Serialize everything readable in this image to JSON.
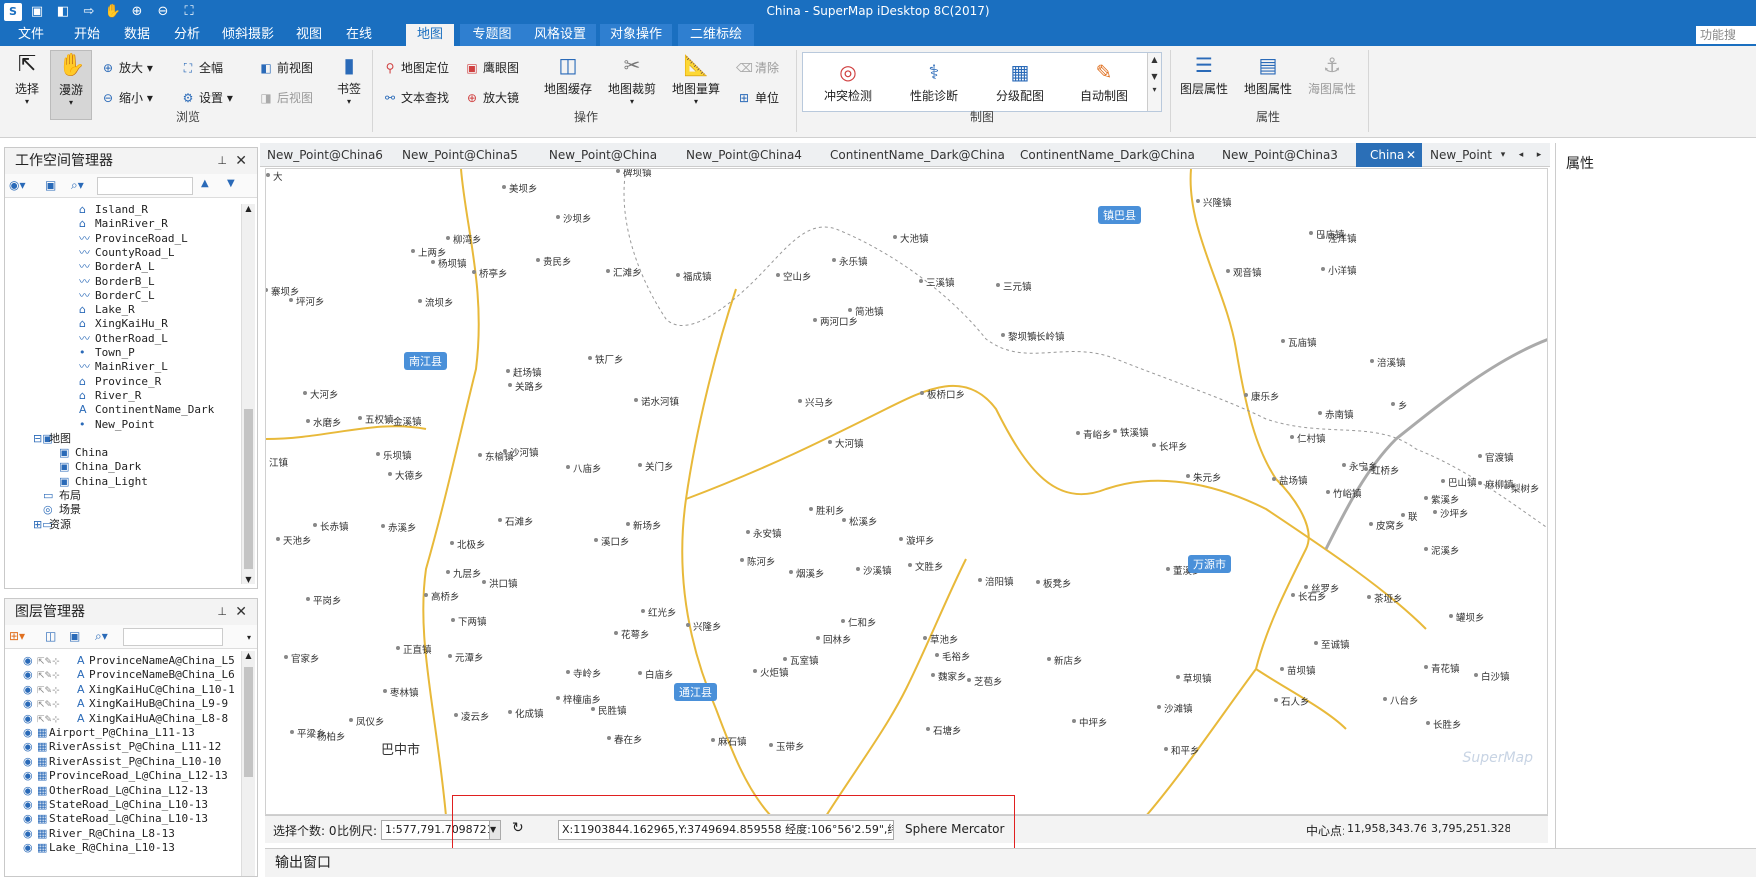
{
  "window": {
    "title": "China - SuperMap iDesktop 8C(2017)"
  },
  "quick_access": [
    "app-logo-icon",
    "save-icon",
    "open-icon",
    "forward-icon",
    "pan-icon",
    "zoom-in-icon",
    "zoom-out-icon",
    "fit-icon"
  ],
  "menus": [
    {
      "label": "文件"
    },
    {
      "label": "开始"
    },
    {
      "label": "数据"
    },
    {
      "label": "分析"
    },
    {
      "label": "倾斜摄影"
    },
    {
      "label": "视图"
    },
    {
      "label": "在线"
    },
    {
      "label": "地图"
    },
    {
      "label": "专题图"
    },
    {
      "label": "风格设置"
    },
    {
      "label": "对象操作"
    },
    {
      "label": "二维标绘"
    }
  ],
  "search": {
    "placeholder": "功能搜"
  },
  "ribbon": {
    "browse": {
      "label": "浏览",
      "select": "选择",
      "pan": "漫游",
      "zoom_in": "放大",
      "zoom_out": "缩小",
      "full_extent": "全幅",
      "settings": "设置",
      "prev_view": "前视图",
      "next_view": "后视图",
      "bookmark": "书签"
    },
    "ops": {
      "label": "操作",
      "map_locate": "地图定位",
      "eagle_eye": "鹰眼图",
      "text_search": "文本查找",
      "magnifier": "放大镜",
      "map_cache": "地图缓存",
      "map_clip": "地图裁剪",
      "map_measure": "地图量算",
      "clear": "清除",
      "unit": "单位"
    },
    "mapping": {
      "label": "制图",
      "conflict": "冲突检测",
      "perf": "性能诊断",
      "graded": "分级配图",
      "auto": "自动制图"
    },
    "props": {
      "label": "属性",
      "layer_props": "图层属性",
      "map_props": "地图属性",
      "chart_props": "海图属性"
    }
  },
  "workspace": {
    "title": "工作空间管理器",
    "items": [
      {
        "label": "Island_R",
        "icon": "region"
      },
      {
        "label": "MainRiver_R",
        "icon": "region"
      },
      {
        "label": "ProvinceRoad_L",
        "icon": "line"
      },
      {
        "label": "CountyRoad_L",
        "icon": "line"
      },
      {
        "label": "BorderA_L",
        "icon": "line"
      },
      {
        "label": "BorderB_L",
        "icon": "line"
      },
      {
        "label": "BorderC_L",
        "icon": "line"
      },
      {
        "label": "Lake_R",
        "icon": "region"
      },
      {
        "label": "XingKaiHu_R",
        "icon": "region"
      },
      {
        "label": "OtherRoad_L",
        "icon": "line"
      },
      {
        "label": "Town_P",
        "icon": "point"
      },
      {
        "label": "MainRiver_L",
        "icon": "line"
      },
      {
        "label": "Province_R",
        "icon": "region"
      },
      {
        "label": "River_R",
        "icon": "region"
      },
      {
        "label": "ContinentName_Dark",
        "icon": "text"
      },
      {
        "label": "New_Point",
        "icon": "point"
      }
    ],
    "maps_label": "地图",
    "maps": [
      "China",
      "China_Dark",
      "China_Light"
    ],
    "layout": "布局",
    "scene": "场景",
    "resources": "资源"
  },
  "layers": {
    "title": "图层管理器",
    "items": [
      {
        "label": "ProvinceNameA@China_L5",
        "icon": "A"
      },
      {
        "label": "ProvinceNameB@China_L6",
        "icon": "A"
      },
      {
        "label": "XingKaiHuC@China_L10-1",
        "icon": "A"
      },
      {
        "label": "XingKaiHuB@China_L9-9",
        "icon": "A"
      },
      {
        "label": "XingKaiHuA@China_L8-8",
        "icon": "A"
      },
      {
        "label": "Airport_P@China_L11-13",
        "icon": "T"
      },
      {
        "label": "RiverAssist_P@China_L11-12",
        "icon": "T"
      },
      {
        "label": "RiverAssist_P@China_L10-10",
        "icon": "T"
      },
      {
        "label": "ProvinceRoad_L@China_L12-13",
        "icon": "T"
      },
      {
        "label": "OtherRoad_L@China_L12-13",
        "icon": "T"
      },
      {
        "label": "StateRoad_L@China_L10-13",
        "icon": "T"
      },
      {
        "label": "StateRoad_L@China_L10-13",
        "icon": "T"
      },
      {
        "label": "River_R@China_L8-13",
        "icon": "T"
      },
      {
        "label": "Lake_R@China_L10-13",
        "icon": "T"
      }
    ]
  },
  "tabs": [
    {
      "label": "New_Point@China6"
    },
    {
      "label": "New_Point@China5"
    },
    {
      "label": "New_Point@China"
    },
    {
      "label": "New_Point@China4"
    },
    {
      "label": "ContinentName_Dark@China"
    },
    {
      "label": "ContinentName_Dark@China"
    },
    {
      "label": "New_Point@China3"
    },
    {
      "label": "China",
      "active": true
    },
    {
      "label": "New_Point"
    }
  ],
  "map": {
    "counties": [
      {
        "name": "镇巴县"
      },
      {
        "name": "南江县"
      },
      {
        "name": "万源市"
      },
      {
        "name": "通江县"
      }
    ],
    "city": "巴中市",
    "watermark": "SuperMap",
    "places": [
      {
        "name": "碑坝镇"
      },
      {
        "name": "美坝乡"
      },
      {
        "name": "沙坝乡"
      },
      {
        "name": "贵民乡"
      },
      {
        "name": "汇滩乡"
      },
      {
        "name": "福成镇"
      },
      {
        "name": "空山乡"
      },
      {
        "name": "永乐镇"
      },
      {
        "name": "大池镇"
      },
      {
        "name": "三溪镇"
      },
      {
        "name": "三元镇"
      },
      {
        "name": "兴隆镇"
      },
      {
        "name": "巴庙镇"
      },
      {
        "name": "泾洋镇"
      },
      {
        "name": "小洋镇"
      },
      {
        "name": "观音镇"
      },
      {
        "name": "两河口乡"
      },
      {
        "name": "简池镇"
      },
      {
        "name": "黎坝镇"
      },
      {
        "name": "长岭镇"
      },
      {
        "name": "瓦庙镇"
      },
      {
        "name": "铁厂乡"
      },
      {
        "name": "诺水河镇"
      },
      {
        "name": "关路乡"
      },
      {
        "name": "赶场镇"
      },
      {
        "name": "流坝乡"
      },
      {
        "name": "杨坝镇"
      },
      {
        "name": "桥亭乡"
      },
      {
        "name": "柳湾乡"
      },
      {
        "name": "上两乡"
      },
      {
        "name": "寨坝乡"
      },
      {
        "name": "坪河乡"
      },
      {
        "name": "大河乡"
      },
      {
        "name": "水磨乡"
      },
      {
        "name": "五权镇"
      },
      {
        "name": "金溪镇"
      },
      {
        "name": "乐坝镇"
      },
      {
        "name": "大德乡"
      },
      {
        "name": "东榆镇"
      },
      {
        "name": "沙河镇"
      },
      {
        "name": "八庙乡"
      },
      {
        "name": "关门乡"
      },
      {
        "name": "兴马乡"
      },
      {
        "name": "大河镇"
      },
      {
        "name": "板桥口乡"
      },
      {
        "name": "青峪乡"
      },
      {
        "name": "铁溪镇"
      },
      {
        "name": "长坪乡"
      },
      {
        "name": "朱元乡"
      },
      {
        "name": "康乐乡"
      },
      {
        "name": "仁村镇"
      },
      {
        "name": "赤南镇"
      },
      {
        "name": "涪溪镇"
      },
      {
        "name": "巴山镇"
      },
      {
        "name": "麻柳镇"
      },
      {
        "name": "沙坪乡"
      },
      {
        "name": "泥溪乡"
      },
      {
        "name": "虹桥乡"
      },
      {
        "name": "竹峪镇"
      },
      {
        "name": "盐场镇"
      },
      {
        "name": "永宁乡"
      },
      {
        "name": "皮窝乡"
      },
      {
        "name": "紫溪乡"
      },
      {
        "name": "梨树乡"
      },
      {
        "name": "官渡镇"
      },
      {
        "name": "天池乡"
      },
      {
        "name": "长赤镇"
      },
      {
        "name": "赤溪乡"
      },
      {
        "name": "北极乡"
      },
      {
        "name": "石滩乡"
      },
      {
        "name": "新场乡"
      },
      {
        "name": "永安镇"
      },
      {
        "name": "胜利乡"
      },
      {
        "name": "松溪乡"
      },
      {
        "name": "漩坪乡"
      },
      {
        "name": "溪口乡"
      },
      {
        "name": "陈河乡"
      },
      {
        "name": "烟溪乡"
      },
      {
        "name": "沙溪镇"
      },
      {
        "name": "文胜乡"
      },
      {
        "name": "九层乡"
      },
      {
        "name": "洪口镇"
      },
      {
        "name": "高桥乡"
      },
      {
        "name": "平岗乡"
      },
      {
        "name": "下两镇"
      },
      {
        "name": "红光乡"
      },
      {
        "name": "仁和乡"
      },
      {
        "name": "涪阳镇"
      },
      {
        "name": "板凳乡"
      },
      {
        "name": "董溪乡"
      },
      {
        "name": "长石乡"
      },
      {
        "name": "丝罗乡"
      },
      {
        "name": "茶垭乡"
      },
      {
        "name": "花萼乡"
      },
      {
        "name": "兴隆乡"
      },
      {
        "name": "回林乡"
      },
      {
        "name": "草池乡"
      },
      {
        "name": "至诚镇"
      },
      {
        "name": "罐坝乡"
      },
      {
        "name": "官家乡"
      },
      {
        "name": "正直镇"
      },
      {
        "name": "元潭乡"
      },
      {
        "name": "寺岭乡"
      },
      {
        "name": "白庙乡"
      },
      {
        "name": "火炬镇"
      },
      {
        "name": "瓦室镇"
      },
      {
        "name": "毛裕乡"
      },
      {
        "name": "新店乡"
      },
      {
        "name": "苗坝镇"
      },
      {
        "name": "青花镇"
      },
      {
        "name": "白沙镇"
      },
      {
        "name": "枣林镇"
      },
      {
        "name": "民胜镇"
      },
      {
        "name": "魏家乡"
      },
      {
        "name": "芝苞乡"
      },
      {
        "name": "草坝镇"
      },
      {
        "name": "石人乡"
      },
      {
        "name": "八台乡"
      },
      {
        "name": "凌云乡"
      },
      {
        "name": "化成镇"
      },
      {
        "name": "梓橦庙乡"
      },
      {
        "name": "中坪乡"
      },
      {
        "name": "沙滩镇"
      },
      {
        "name": "凤仪乡"
      },
      {
        "name": "平梁乡"
      },
      {
        "name": "杨柏乡"
      },
      {
        "name": "春在乡"
      },
      {
        "name": "麻石镇"
      },
      {
        "name": "玉带乡"
      },
      {
        "name": "石塘乡"
      },
      {
        "name": "长胜乡"
      },
      {
        "name": "和平乡"
      },
      {
        "name": "江镇"
      },
      {
        "name": "乡"
      },
      {
        "name": "联"
      },
      {
        "name": "大"
      }
    ]
  },
  "status": {
    "selected_label": "选择个数: 0",
    "scale_label": "比例尺:",
    "scale_value": "1:577,791.709872198",
    "coords": "X:11903844.162965,Y:3749694.859558   经度:106°56'2.59\",纬度:31°53'46",
    "projection": "Sphere Mercator",
    "center_label": "中心点:",
    "center_x": "11,958,343.76...",
    "center_y": "3,795,251.328..."
  },
  "output": {
    "label": "输出窗口"
  },
  "properties": {
    "title": "属性"
  },
  "colors": {
    "title_bar": "#1a6fc0",
    "county_badge": "#4a90d9",
    "road": "#e8b93a",
    "highlight": "#e02020"
  }
}
